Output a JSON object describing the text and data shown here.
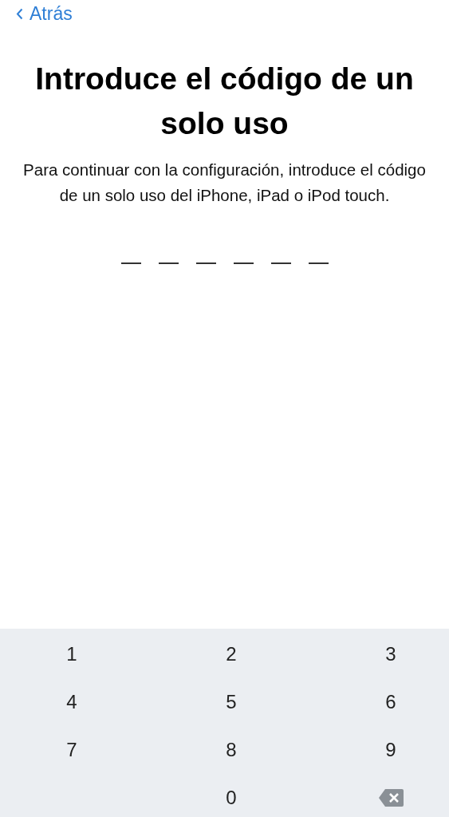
{
  "nav": {
    "back_label": "Atrás"
  },
  "title": "Introduce el código de un solo uso",
  "description": "Para continuar con la configuración, introduce el código de un solo uso del iPhone, iPad o iPod touch.",
  "code_slots": [
    {
      "filled": false
    },
    {
      "filled": false
    },
    {
      "filled": false
    },
    {
      "filled": false
    },
    {
      "filled": false
    },
    {
      "filled": false
    }
  ],
  "keypad": [
    {
      "kind": "digit",
      "label": "1"
    },
    {
      "kind": "digit",
      "label": "2"
    },
    {
      "kind": "digit",
      "label": "3"
    },
    {
      "kind": "digit",
      "label": "4"
    },
    {
      "kind": "digit",
      "label": "5"
    },
    {
      "kind": "digit",
      "label": "6"
    },
    {
      "kind": "digit",
      "label": "7"
    },
    {
      "kind": "digit",
      "label": "8"
    },
    {
      "kind": "digit",
      "label": "9"
    },
    {
      "kind": "digit",
      "label": "0"
    },
    {
      "kind": "delete"
    }
  ]
}
